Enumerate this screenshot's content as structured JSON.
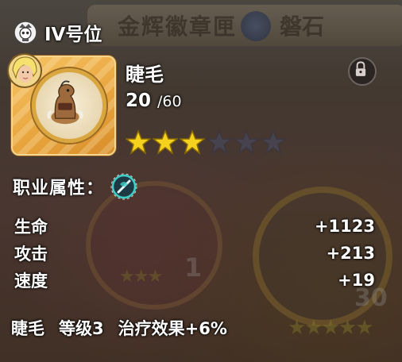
{
  "header": {
    "title": "IV号位",
    "icon": "skull-emblem-icon"
  },
  "hero": {
    "name": "睫毛",
    "level": "20",
    "level_max": "/60",
    "stars_filled": 3,
    "stars_total": 6
  },
  "class_section": {
    "label": "职业属性：",
    "icon": "healer-class-icon"
  },
  "stats": [
    {
      "name": "生命",
      "value": "+1123"
    },
    {
      "name": "攻击",
      "value": "+213"
    },
    {
      "name": "速度",
      "value": "+19"
    }
  ],
  "footer": {
    "name": "睫毛",
    "grade": "等级3",
    "bonus": "治疗效果+6%"
  },
  "background": {
    "banner_left": "金辉徽章匣",
    "banner_right": "磐石",
    "num1": "1",
    "num2": "30"
  },
  "colors": {
    "star": "#f5d21e",
    "frame": "#e8a43c",
    "accent": "#3fd1c8"
  }
}
